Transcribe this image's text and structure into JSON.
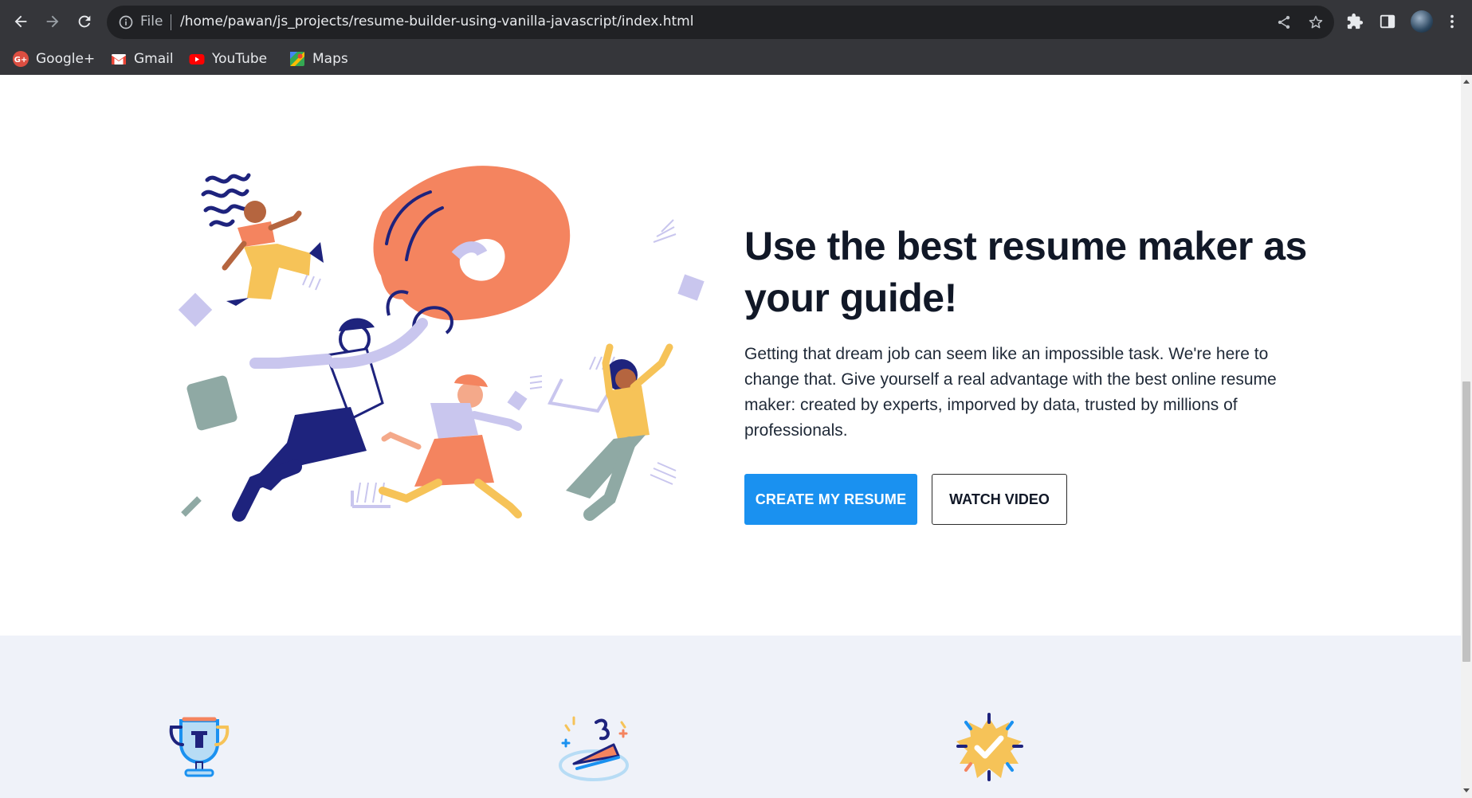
{
  "browser": {
    "address": {
      "scheme_label": "File",
      "url": "/home/pawan/js_projects/resume-builder-using-vanilla-javascript/index.html"
    },
    "bookmarks": [
      {
        "label": "Google+",
        "icon": "google-plus-icon"
      },
      {
        "label": "Gmail",
        "icon": "gmail-icon"
      },
      {
        "label": "YouTube",
        "icon": "youtube-icon"
      },
      {
        "label": "Maps",
        "icon": "maps-icon"
      }
    ]
  },
  "hero": {
    "title": "Use the best resume maker as your guide!",
    "description": "Getting that dream job can seem like an impossible task. We're here to change that. Give yourself a real advantage with the best online resume maker: created by experts, imporved by data, trusted by millions of professionals.",
    "primary_button": "CREATE MY RESUME",
    "secondary_button": "WATCH VIDEO"
  },
  "features": {
    "icons": [
      "trophy-icon",
      "pie-slice-icon",
      "verified-badge-icon"
    ]
  },
  "colors": {
    "primary": "#1a91f0",
    "heading": "#111827",
    "features_bg": "#eff2f9",
    "illustration_orange": "#f4845f",
    "illustration_navy": "#1e237d",
    "illustration_yellow": "#f6c358",
    "illustration_lavender": "#c9c6ee"
  }
}
